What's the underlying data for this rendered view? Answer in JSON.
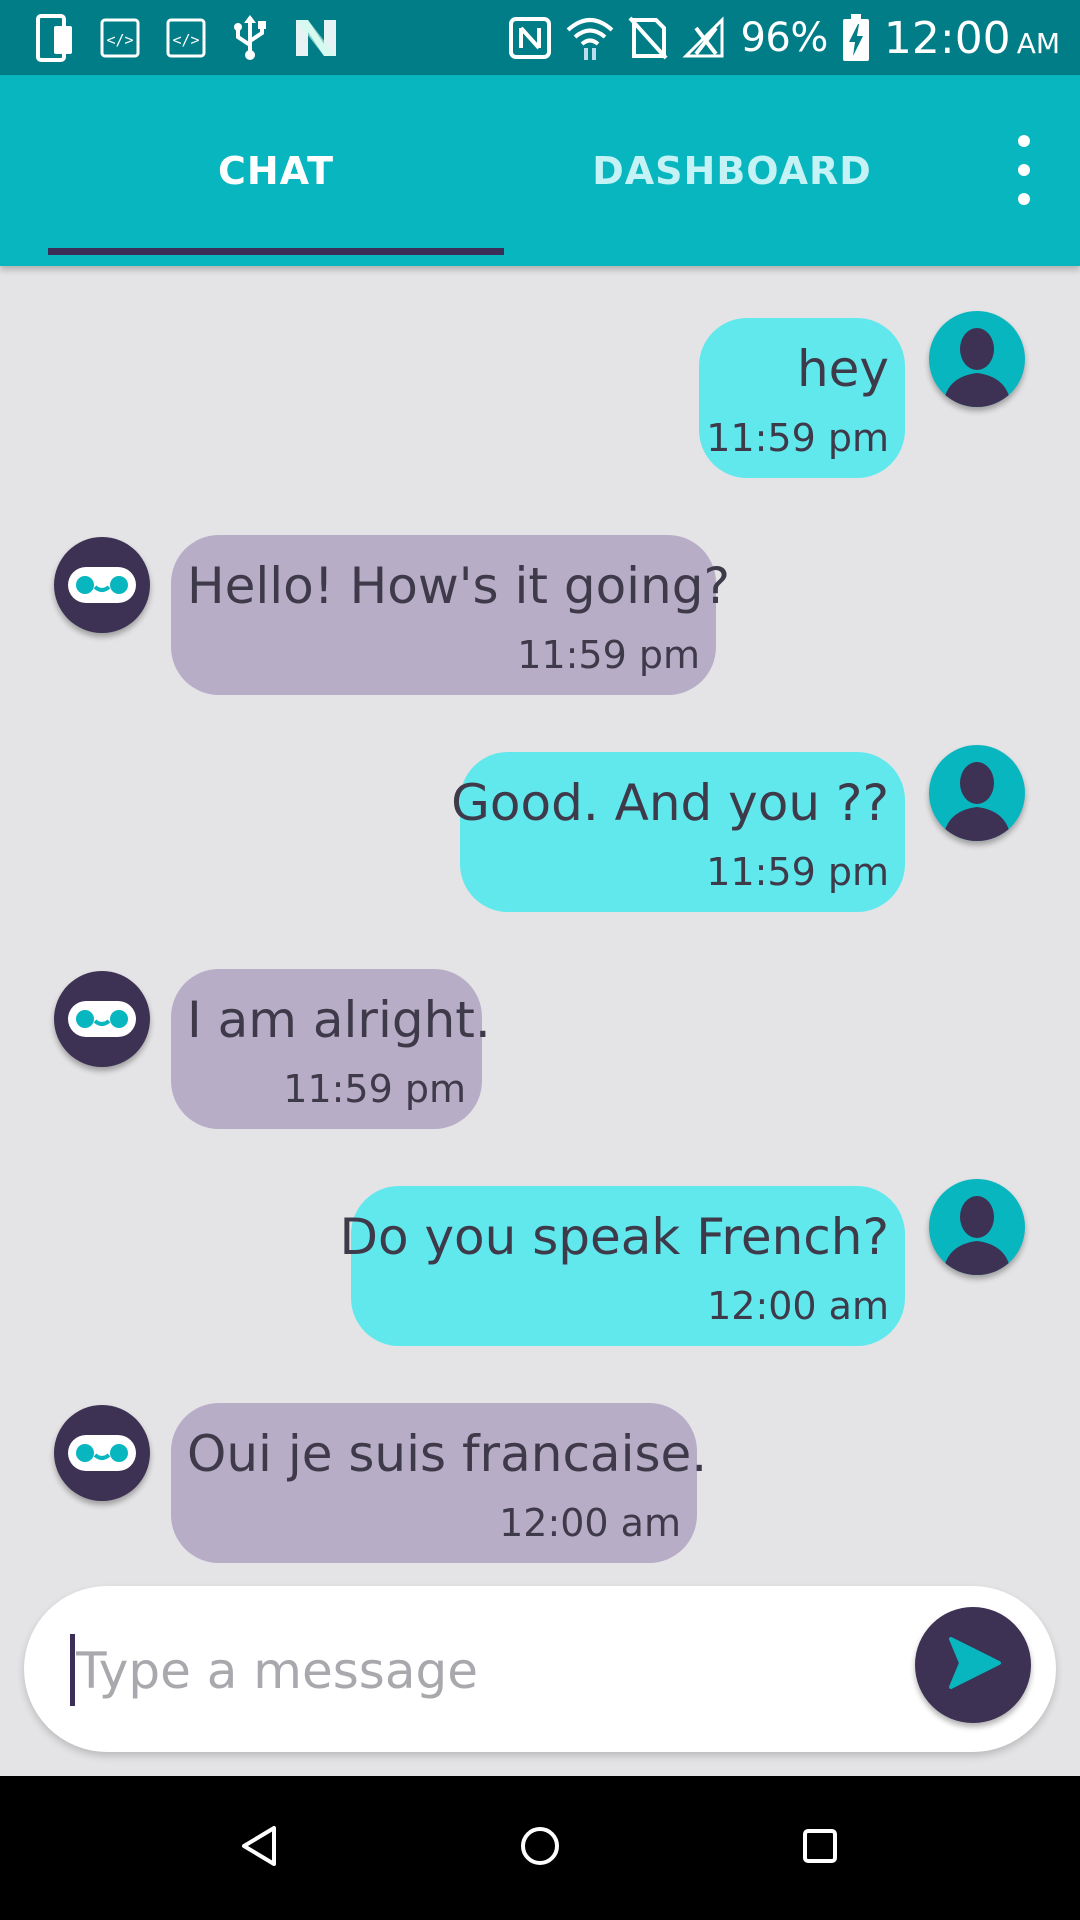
{
  "status_bar": {
    "battery_percent": "96%",
    "time": "12:00",
    "ampm": "AM",
    "left_icons": [
      "device-icon",
      "code-icon",
      "code-icon",
      "usb-icon",
      "n-logo-icon"
    ],
    "right_icons": [
      "nfc-icon",
      "wifi-icon",
      "no-sim-icon",
      "no-signal-icon",
      "battery-charging-icon"
    ]
  },
  "tabs": [
    {
      "label": "CHAT",
      "selected": true
    },
    {
      "label": "DASHBOARD",
      "selected": false
    }
  ],
  "messages": [
    {
      "sender": "user",
      "text": "hey",
      "time": "11:59 pm"
    },
    {
      "sender": "bot",
      "text": "Hello! How's it going?",
      "time": "11:59 pm"
    },
    {
      "sender": "user",
      "text": "Good. And you ??",
      "time": "11:59 pm"
    },
    {
      "sender": "bot",
      "text": "I am alright.",
      "time": "11:59 pm"
    },
    {
      "sender": "user",
      "text": "Do you speak French?",
      "time": "12:00 am"
    },
    {
      "sender": "bot",
      "text": "Oui je suis francaise.",
      "time": "12:00 am"
    }
  ],
  "composer": {
    "placeholder": "Type a message",
    "value": ""
  },
  "colors": {
    "status_bar": "#007d86",
    "app_bar": "#08b6c0",
    "tab_indicator": "#3d2e57",
    "user_bubble": "#60e8ed",
    "bot_bubble": "#b7adc7",
    "background": "#e4e4e6",
    "bot_avatar": "#3d3154"
  }
}
